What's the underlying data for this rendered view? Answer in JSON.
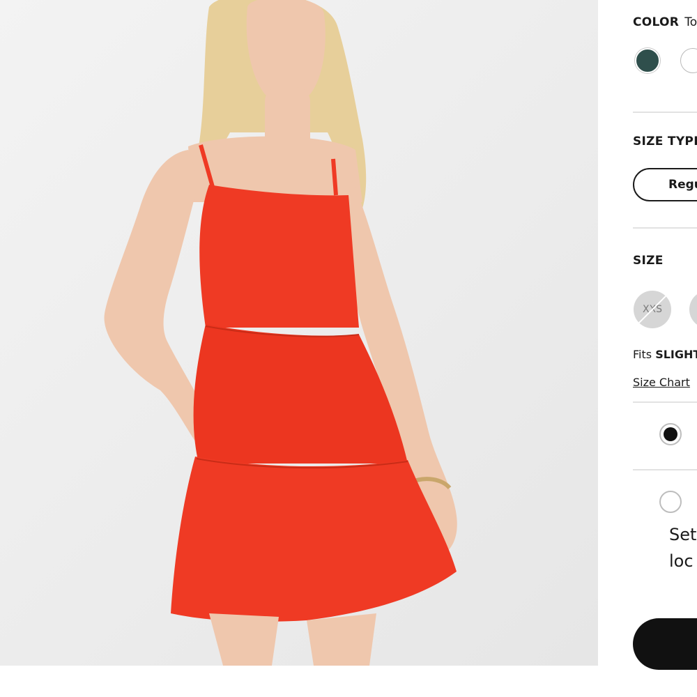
{
  "product_image": {
    "alt": "Model wearing red tiered mini dress",
    "background_color": "#eeeeee",
    "dress_color": "#ef3a24"
  },
  "color": {
    "label": "COLOR",
    "selected_name": "To",
    "swatches": [
      {
        "name": "green-swatch",
        "hex": "#2f4f4c"
      },
      {
        "name": "white-swatch",
        "hex": "#ffffff"
      }
    ]
  },
  "size_type": {
    "label": "SIZE TYPE",
    "selected": "Regu"
  },
  "size": {
    "label": "SIZE",
    "options": [
      {
        "label": "XXS",
        "available": false
      },
      {
        "label": "",
        "available": true
      }
    ],
    "fits_prefix": "Fits",
    "fits_emphasis": "SLIGHT",
    "size_chart_link": "Size Chart"
  },
  "delivery": {
    "option_1_text": "",
    "option_2_text": "",
    "store_line_1": "Set",
    "store_line_2": "loc"
  },
  "cta": {
    "add_button_color": "#111111"
  }
}
